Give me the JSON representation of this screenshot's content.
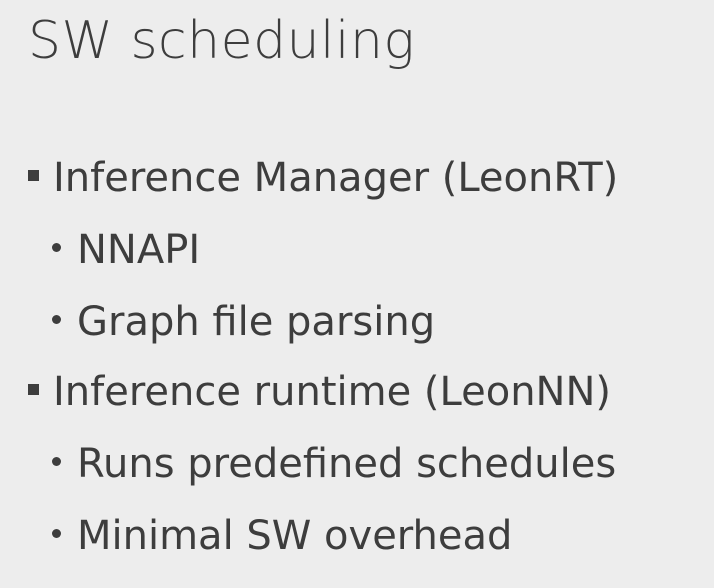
{
  "slide": {
    "title": "SW scheduling",
    "bullets": [
      {
        "text": "Inference Manager (LeonRT)",
        "level": 1
      },
      {
        "text": "NNAPI",
        "level": 2
      },
      {
        "text": "Graph file parsing",
        "level": 2
      },
      {
        "text": "Inference runtime (LeonNN)",
        "level": 1
      },
      {
        "text": "Runs predefined schedules",
        "level": 2
      },
      {
        "text": "Minimal SW overhead",
        "level": 2
      }
    ]
  }
}
